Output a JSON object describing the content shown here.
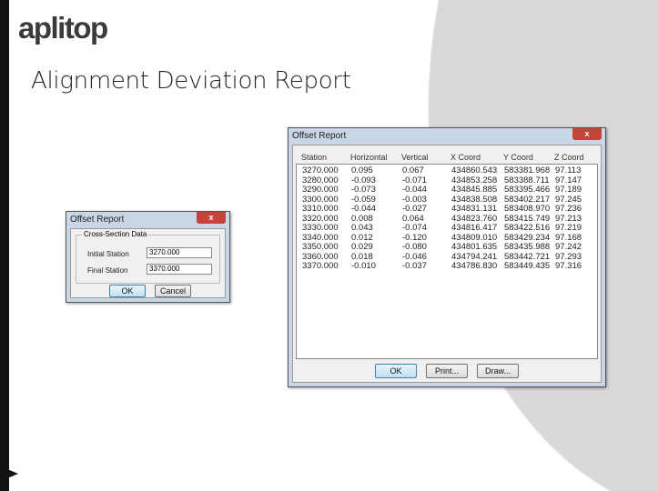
{
  "slide": {
    "logo": "aplitop",
    "title": "Alignment Deviation Report"
  },
  "small_dialog": {
    "title": "Offset Report",
    "close": "x",
    "group": "Cross-Section Data",
    "initial_label": "Initial Station",
    "initial_value": "3270.000",
    "final_label": "Final Station",
    "final_value": "3370.000",
    "ok": "OK",
    "cancel": "Cancel"
  },
  "report": {
    "title": "Offset Report",
    "close": "x",
    "columns": [
      "Station",
      "Horizontal",
      "Vertical",
      "X Coord",
      "Y Coord",
      "Z Coord"
    ],
    "rows": [
      [
        "3270.000",
        "0.095",
        "0.067",
        "434860.543",
        "583381.968",
        "97.113"
      ],
      [
        "3280.000",
        "-0.093",
        "-0.071",
        "434853.258",
        "583388.711",
        "97.147"
      ],
      [
        "3290.000",
        "-0.073",
        "-0.044",
        "434845.885",
        "583395.466",
        "97.189"
      ],
      [
        "3300.000",
        "-0.059",
        "-0.003",
        "434838.508",
        "583402.217",
        "97.245"
      ],
      [
        "3310.000",
        "-0.044",
        "-0.027",
        "434831.131",
        "583408.970",
        "97.236"
      ],
      [
        "3320.000",
        "0.008",
        "0.064",
        "434823.760",
        "583415.749",
        "97.213"
      ],
      [
        "3330.000",
        "0.043",
        "-0.074",
        "434816.417",
        "583422.516",
        "97.219"
      ],
      [
        "3340.000",
        "0.012",
        "-0.120",
        "434809.010",
        "583429.234",
        "97.168"
      ],
      [
        "3350.000",
        "0.029",
        "-0.080",
        "434801.635",
        "583435.988",
        "97.242"
      ],
      [
        "3360.000",
        "0.018",
        "-0.046",
        "434794.241",
        "583442.721",
        "97.293"
      ],
      [
        "3370.000",
        "-0.010",
        "-0.037",
        "434786.830",
        "583449.435",
        "97.316"
      ]
    ],
    "ok": "OK",
    "print": "Print...",
    "draw": "Draw..."
  }
}
